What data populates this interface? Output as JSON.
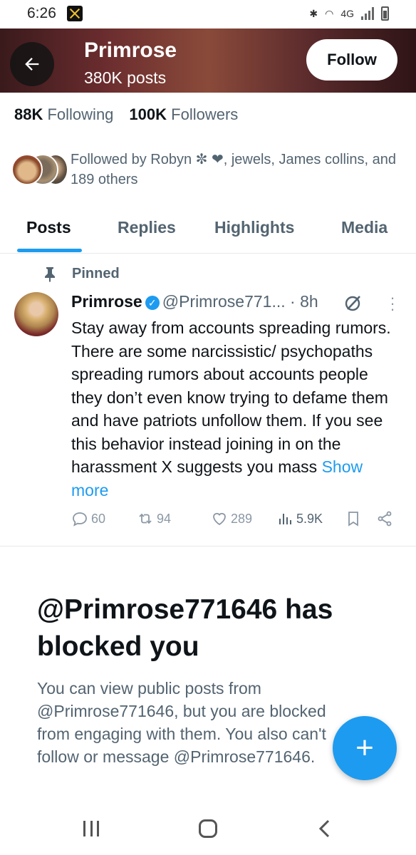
{
  "status_bar": {
    "time": "6:26",
    "network": "4G"
  },
  "header": {
    "name": "Primrose",
    "post_count": "380K posts",
    "follow_label": "Follow"
  },
  "stats": {
    "following_count": "88K",
    "following_label": "Following",
    "followers_count": "100K",
    "followers_label": "Followers"
  },
  "followed_by": {
    "text": "Followed by Robyn ✼ ❤, jewels, James collins, and 189 others"
  },
  "tabs": [
    {
      "label": "Posts"
    },
    {
      "label": "Replies"
    },
    {
      "label": "Highlights"
    },
    {
      "label": "Media"
    }
  ],
  "post": {
    "pinned_label": "Pinned",
    "author": "Primrose",
    "handle": "@Primrose771...",
    "time": "· 8h",
    "body": "Stay away from accounts spreading rumors. There are some narcissistic/ psychopaths spreading rumors about accounts people they don’t even know trying to defame them and have patriots unfollow them. If you see this behavior instead joining in on the harassment X suggests you mass",
    "show_more": "Show more",
    "replies": "60",
    "reposts": "94",
    "likes": "289",
    "views": "5.9K"
  },
  "blocked": {
    "title": "@Primrose771646 has blocked you",
    "body": "You can view public posts from @Primrose771646, but you are blocked from engaging with them. You also can't follow or message @Primrose771646."
  },
  "fab": {
    "label": "+"
  },
  "colors": {
    "accent": "#1d9bf0",
    "text": "#0f1419",
    "secondary": "#536471"
  }
}
